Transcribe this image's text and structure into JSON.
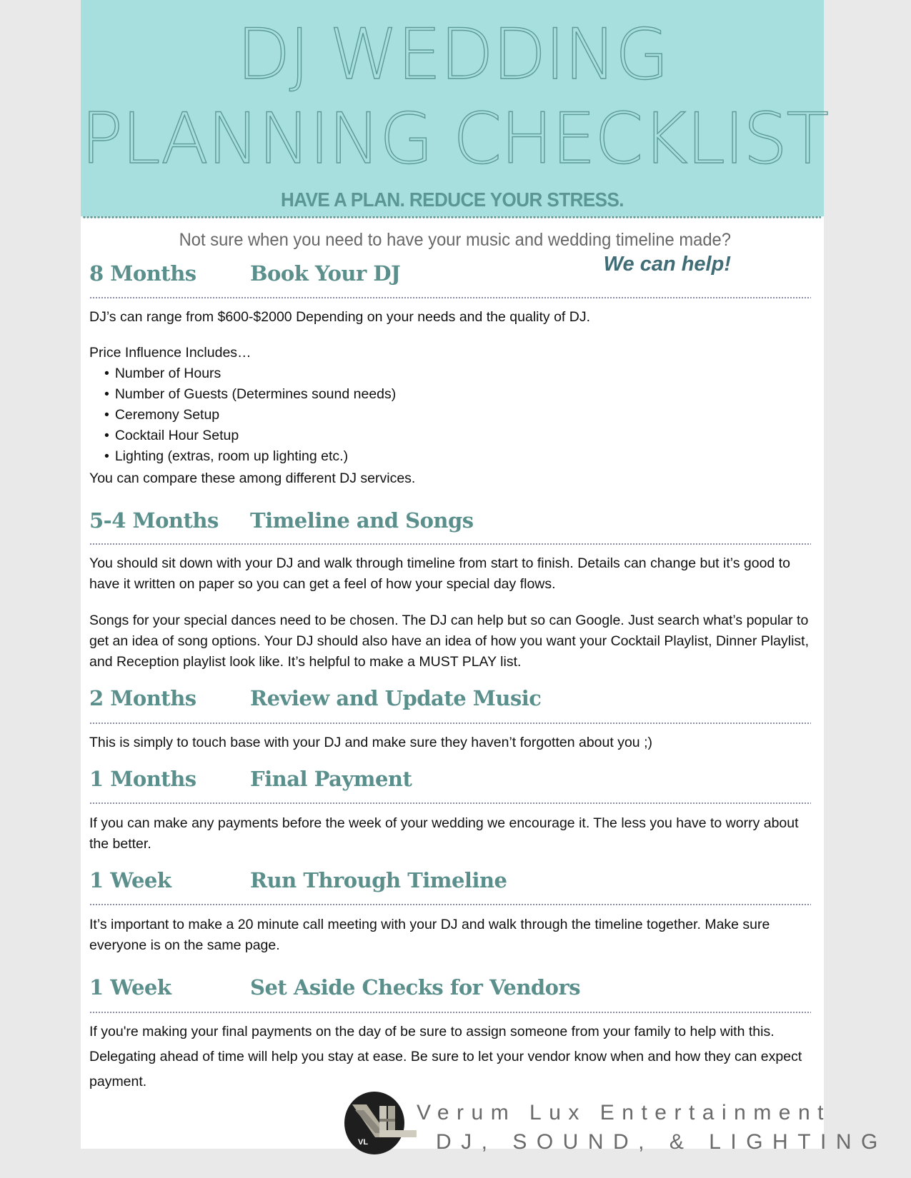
{
  "header": {
    "title_line_1": "DJ WEDDING",
    "title_line_2": "PLANNING CHECKLIST",
    "tagline": "HAVE A PLAN. REDUCE YOUR STRESS."
  },
  "intro": {
    "question": "Not sure when you need to have your music and wedding timeline made?",
    "callout": "We can help!"
  },
  "sections": [
    {
      "when": "8 Months",
      "what": "Book Your DJ",
      "paragraphs": [
        "DJ’s can range from $600-$2000 Depending on your needs and the quality of DJ.",
        "Price Influence Includes…"
      ],
      "bullets": [
        "Number of Hours",
        "Number of Guests (Determines sound needs)",
        "Ceremony Setup",
        "Cocktail Hour Setup",
        "Lighting (extras, room up lighting etc.)"
      ],
      "closing": "You can compare these among different DJ services."
    },
    {
      "when": "5-4 Months",
      "what": "Timeline and Songs",
      "paragraphs": [
        "You should sit down with your DJ and walk through timeline from start to finish. Details can change but it’s good to have it written on paper so you can get a feel of how your special day flows.",
        "Songs for your special dances need to be chosen. The DJ can help but so can Google. Just search what’s popular to get an idea of song options. Your DJ should also have an idea of how you want your Cocktail Playlist, Dinner Playlist, and Reception playlist look like. It’s helpful to make a MUST PLAY list."
      ]
    },
    {
      "when": "2 Months",
      "what": "Review and Update Music",
      "paragraphs": [
        "This is simply to touch base with your DJ and make sure they haven’t forgotten about you ;)"
      ]
    },
    {
      "when": "1 Months",
      "what": "Final Payment",
      "paragraphs": [
        "If you can make any payments before the week of your wedding we encourage it. The less you have to worry about the better."
      ]
    },
    {
      "when": "1 Week",
      "what": "Run Through Timeline",
      "paragraphs": [
        "It’s important to make a 20 minute call meeting with your DJ and walk through the timeline together. Make sure everyone is on the same page."
      ]
    },
    {
      "when": "1 Week",
      "what": "Set Aside Checks for Vendors",
      "paragraphs": [
        "If you're making your final payments on the day of be sure to assign someone from your family to help with this. Delegating ahead of time will help you stay at ease. Be sure to let your vendor know when and how they can expect payment."
      ]
    }
  ],
  "footer": {
    "logo_initials": "VL",
    "company": "Verum Lux Entertainment",
    "services": "DJ, SOUND, & LIGHTING"
  },
  "colors": {
    "header_bg": "#a7dfde",
    "accent_teal": "#5a8f8c",
    "callout": "#3f6c75",
    "page_bg": "#e9e9e9"
  }
}
